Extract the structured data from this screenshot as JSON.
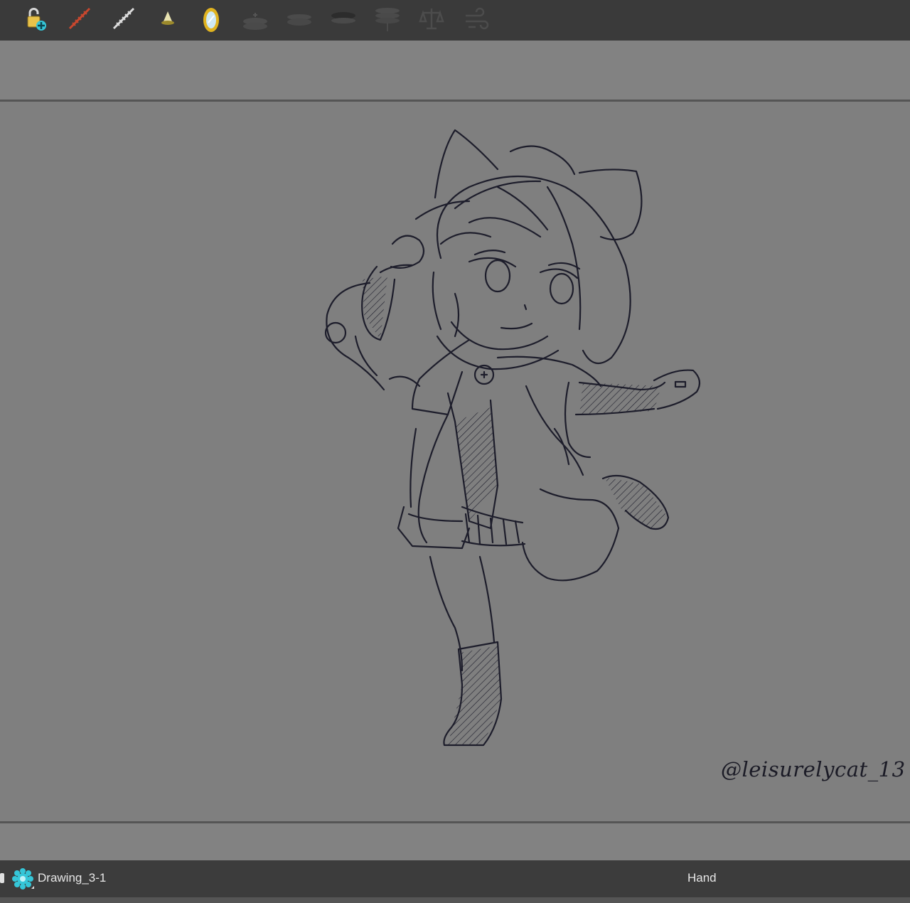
{
  "toolbar": {
    "tools": [
      {
        "icon": "lock-add-icon"
      },
      {
        "icon": "red-ruler-icon"
      },
      {
        "icon": "white-ruler-icon"
      },
      {
        "icon": "lamp-icon"
      },
      {
        "icon": "mirror-icon"
      },
      {
        "icon": "layer-stack-add-icon"
      },
      {
        "icon": "layer-stack-flat-icon"
      },
      {
        "icon": "layer-stack-dark-icon"
      },
      {
        "icon": "layer-stack-pin-icon"
      },
      {
        "icon": "balance-icon"
      },
      {
        "icon": "wind-icon"
      }
    ]
  },
  "canvas": {
    "signature": "@leisurelycat_13",
    "stroke_color": "#1d1d2b"
  },
  "statusbar": {
    "drawing_name": "Drawing_3-1",
    "current_tool": "Hand"
  },
  "colors": {
    "toolbar_bg": "#3a3a3a",
    "canvas_bg": "#7f7f7f",
    "statusbar_bg": "#3c3c3c",
    "accent_cyan": "#35c6d8",
    "mirror_gold": "#e0b320"
  }
}
